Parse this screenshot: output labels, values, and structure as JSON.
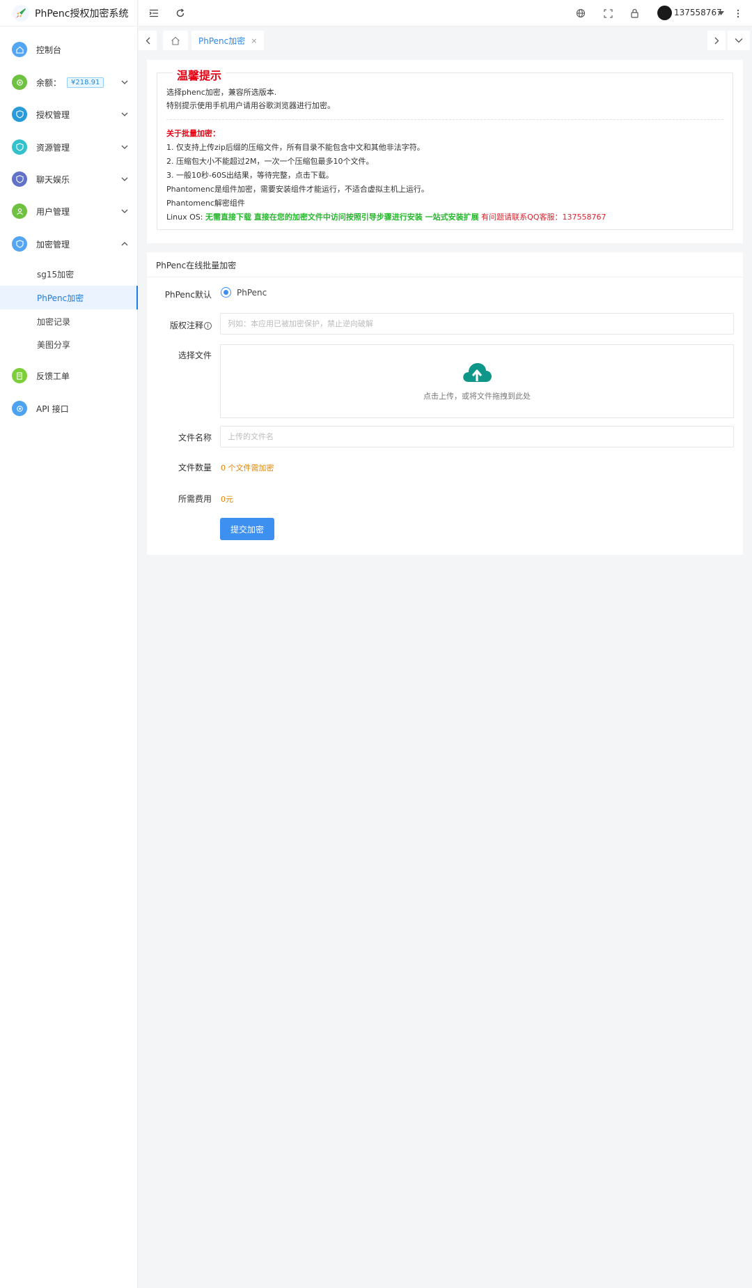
{
  "app": {
    "title": "PhPenc授权加密系统"
  },
  "sidebar": {
    "items": [
      {
        "label": "控制台",
        "color": "#55a6f2"
      },
      {
        "label": "余额：",
        "badge": "¥218.91",
        "color": "#6fc241"
      },
      {
        "label": "授权管理",
        "color": "#2a9ad8"
      },
      {
        "label": "资源管理",
        "color": "#33c1cc"
      },
      {
        "label": "聊天娱乐",
        "color": "#6272c8"
      },
      {
        "label": "用户管理",
        "color": "#6fc241"
      },
      {
        "label": "加密管理",
        "color": "#55a6f2"
      },
      {
        "label": "反馈工单",
        "color": "#7ccf38"
      },
      {
        "label": "API 接口",
        "color": "#4da3ef"
      }
    ],
    "sub_items": [
      {
        "label": "sg15加密"
      },
      {
        "label": "PhPenc加密",
        "active": true
      },
      {
        "label": "加密记录"
      },
      {
        "label": "美图分享"
      }
    ]
  },
  "topbar": {
    "user": "137558767"
  },
  "tabs": {
    "current": "PhPenc加密",
    "close": "×"
  },
  "notice": {
    "title": "温馨提示",
    "line1": "选择phenc加密，兼容所选版本.",
    "line2": "特别提示使用手机用户请用谷歌浏览器进行加密。",
    "batch_title": "关于批量加密：",
    "batch1": "1. 仅支持上传zip后缀的压缩文件，所有目录不能包含中文和其他非法字符。",
    "batch2": "2. 压缩包大小不能超过2M，一次一个压缩包最多10个文件。",
    "batch3": "3. 一般10秒-60S出结果，等待完整，点击下载。",
    "phantom1": "Phantomenc是组件加密，需要安装组件才能运行，不适合虚拟主机上运行。",
    "phantom2": "Phantomenc解密组件",
    "linux_prefix": "Linux OS: ",
    "linux_green": "无需直接下载 直接在您的加密文件中访问按照引导步骤进行安装 一站式安装扩展",
    "linux_red": "有问题请联系QQ客服：137558767"
  },
  "form": {
    "title": "PhPenc在线批量加密",
    "default_label": "PhPenc默认",
    "radio_label": "PhPenc",
    "copyright_label": "版权注释",
    "copyright_placeholder": "列如：本应用已被加密保护，禁止逆向破解",
    "file_label": "选择文件",
    "upload_text": "点击上传，或将文件拖拽到此处",
    "filename_label": "文件名称",
    "filename_placeholder": "上传的文件名",
    "count_label": "文件数量",
    "count_value": "0 个文件需加密",
    "fee_label": "所需费用",
    "fee_value": "0元",
    "submit": "提交加密"
  },
  "colors": {
    "accent": "#1e7ce0",
    "notice_red": "#e60012",
    "green": "#25b82c",
    "orange": "#e4850a",
    "upload_icon": "#0e9688"
  }
}
